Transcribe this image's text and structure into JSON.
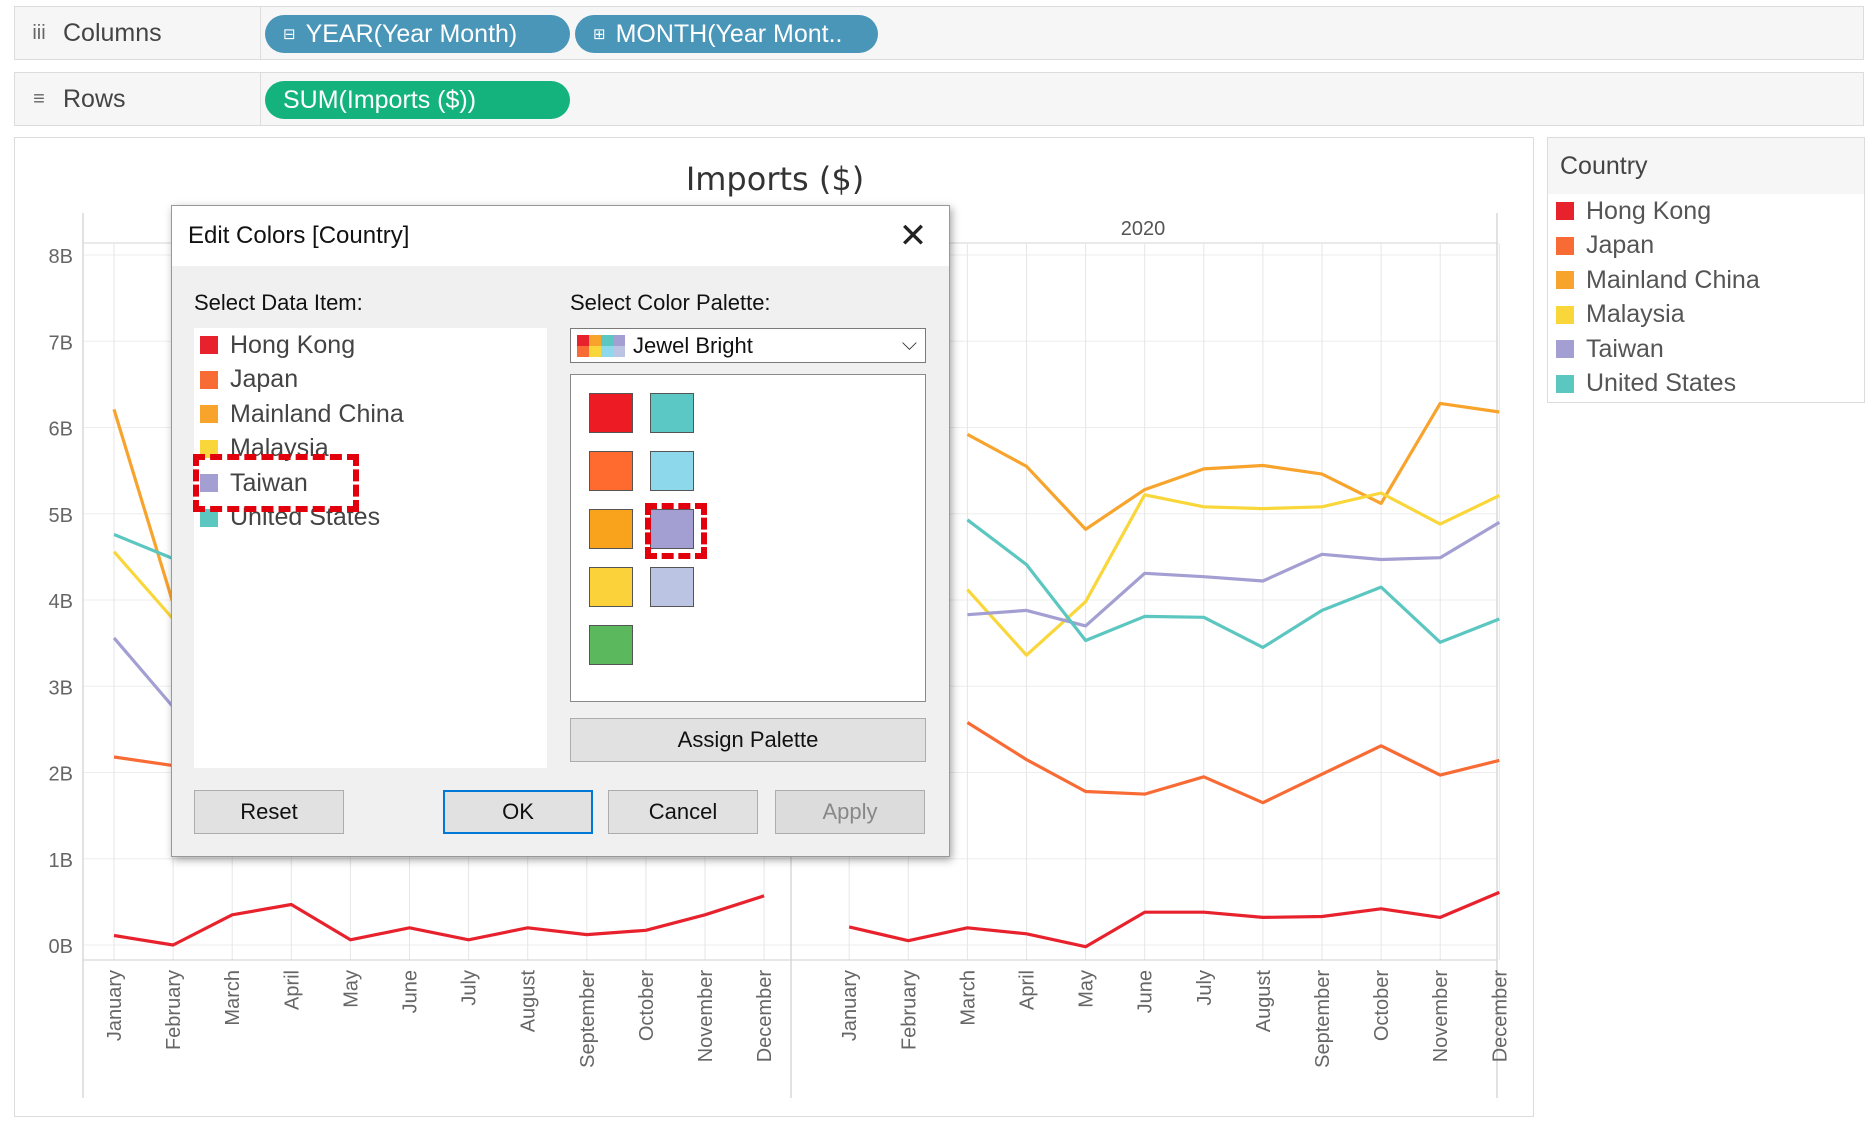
{
  "shelves": {
    "columns": {
      "label": "Columns",
      "icon": "iii",
      "pills": [
        "YEAR(Year Month)",
        "MONTH(Year Mont.."
      ]
    },
    "rows": {
      "label": "Rows",
      "icon": "≡",
      "pills": [
        "SUM(Imports ($))"
      ]
    },
    "pill_icon": "⊟"
  },
  "legend": {
    "title": "Country",
    "items": [
      {
        "label": "Hong Kong",
        "color": "#e8222d"
      },
      {
        "label": "Japan",
        "color": "#f96b35"
      },
      {
        "label": "Mainland China",
        "color": "#f8a32c"
      },
      {
        "label": "Malaysia",
        "color": "#f9d73b"
      },
      {
        "label": "Taiwan",
        "color": "#a39fd2"
      },
      {
        "label": "United States",
        "color": "#5cc6c1"
      }
    ]
  },
  "dialog": {
    "title": "Edit Colors [Country]",
    "close_glyph": "✕",
    "select_item_label": "Select Data Item:",
    "select_palette_label": "Select Color Palette:",
    "palette_value": "Jewel Bright",
    "chevron_glyph": "⌵",
    "palette_swatches": [
      "#ed1c24",
      "#5bc8c6",
      "#ff6b2f",
      "#8ed8ec",
      "#f9a21c",
      "#a39fd2",
      "#fbd23a",
      "#bcc4e3",
      "#5cb85c"
    ],
    "buttons": {
      "assign": "Assign Palette",
      "reset": "Reset",
      "ok": "OK",
      "cancel": "Cancel",
      "apply": "Apply"
    }
  },
  "chart_data": {
    "type": "line",
    "title": "Imports ($)",
    "year_headers": [
      "2020"
    ],
    "yticks": [
      "8B",
      "7B",
      "6B",
      "5B",
      "4B",
      "3B",
      "2B",
      "1B",
      "0B"
    ],
    "ylim": [
      0,
      8
    ],
    "categories": [
      "January",
      "February",
      "March",
      "April",
      "May",
      "June",
      "July",
      "August",
      "September",
      "October",
      "November",
      "December",
      "January",
      "February",
      "March",
      "April",
      "May",
      "June",
      "July",
      "August",
      "September",
      "October",
      "November",
      "December"
    ],
    "series": [
      {
        "name": "Hong Kong",
        "color": "#e8222d",
        "values": [
          0.11,
          0.0,
          0.35,
          0.47,
          0.06,
          0.2,
          0.06,
          0.2,
          0.12,
          0.17,
          0.35,
          0.57,
          0.21,
          0.05,
          0.2,
          0.13,
          -0.02,
          0.38,
          0.38,
          0.32,
          0.33,
          0.42,
          0.32,
          0.61
        ]
      },
      {
        "name": "Japan",
        "color": "#f96b35",
        "values": [
          2.18,
          2.08,
          null,
          null,
          null,
          null,
          null,
          null,
          null,
          null,
          null,
          null,
          null,
          null,
          2.58,
          2.15,
          1.78,
          1.75,
          1.95,
          1.65,
          1.98,
          2.31,
          1.97,
          2.14
        ]
      },
      {
        "name": "Mainland China",
        "color": "#f8a32c",
        "values": [
          6.21,
          3.96,
          null,
          null,
          null,
          null,
          null,
          null,
          null,
          null,
          null,
          null,
          null,
          null,
          5.92,
          5.55,
          4.82,
          5.28,
          5.52,
          5.56,
          5.46,
          5.12,
          6.28,
          6.18
        ]
      },
      {
        "name": "Malaysia",
        "color": "#f9d73b",
        "values": [
          4.56,
          3.78,
          null,
          null,
          null,
          null,
          null,
          null,
          null,
          null,
          null,
          null,
          null,
          null,
          4.12,
          3.36,
          3.98,
          5.22,
          5.08,
          5.06,
          5.08,
          5.24,
          4.88,
          5.21
        ]
      },
      {
        "name": "Taiwan",
        "color": "#a39fd2",
        "values": [
          3.56,
          2.76,
          null,
          null,
          null,
          null,
          null,
          null,
          null,
          null,
          null,
          null,
          null,
          null,
          3.83,
          3.88,
          3.7,
          4.31,
          4.27,
          4.22,
          4.53,
          4.47,
          4.49,
          4.9
        ]
      },
      {
        "name": "United States",
        "color": "#5cc6c1",
        "values": [
          4.76,
          4.48,
          null,
          null,
          null,
          null,
          null,
          null,
          null,
          null,
          null,
          null,
          null,
          null,
          4.93,
          4.41,
          3.53,
          3.81,
          3.8,
          3.45,
          3.88,
          4.15,
          3.51,
          3.78
        ]
      }
    ]
  }
}
